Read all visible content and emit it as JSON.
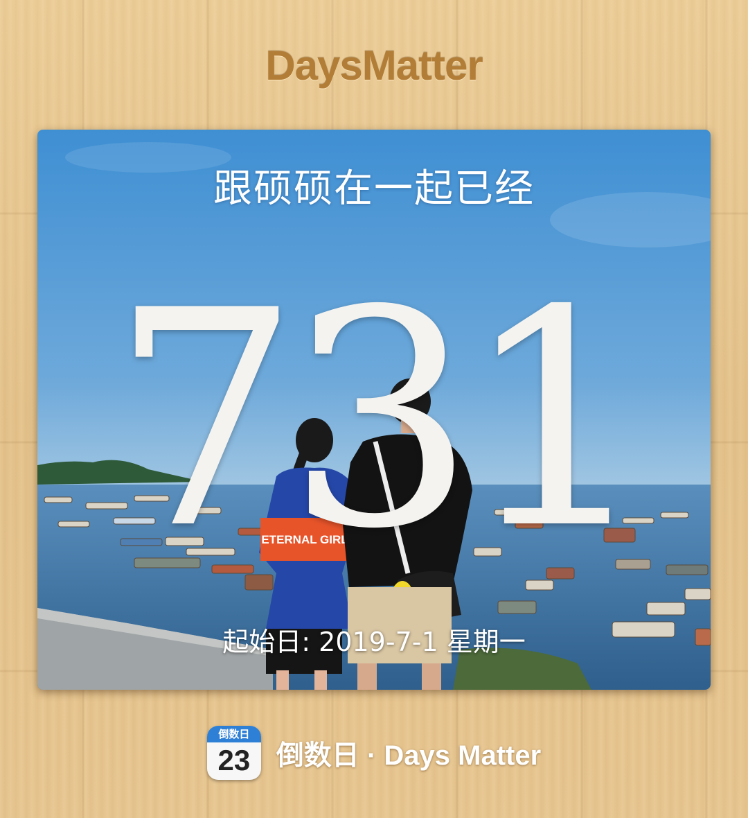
{
  "app": {
    "title": "DaysMatter"
  },
  "card": {
    "title": "跟硕硕在一起已经",
    "day_count": "731",
    "start_date": "起始日: 2019-7-1 星期一",
    "photo_shirt_text": "ETERNAL GIRL"
  },
  "footer": {
    "icon_header": "倒数日",
    "icon_number": "23",
    "label": "倒数日 · Days Matter"
  },
  "colors": {
    "wood": "#e6c690",
    "title": "#b27d36",
    "sky_top": "#3f8fd3",
    "sea": "#3a6f9e",
    "icon_blue": "#2e7fd6"
  }
}
